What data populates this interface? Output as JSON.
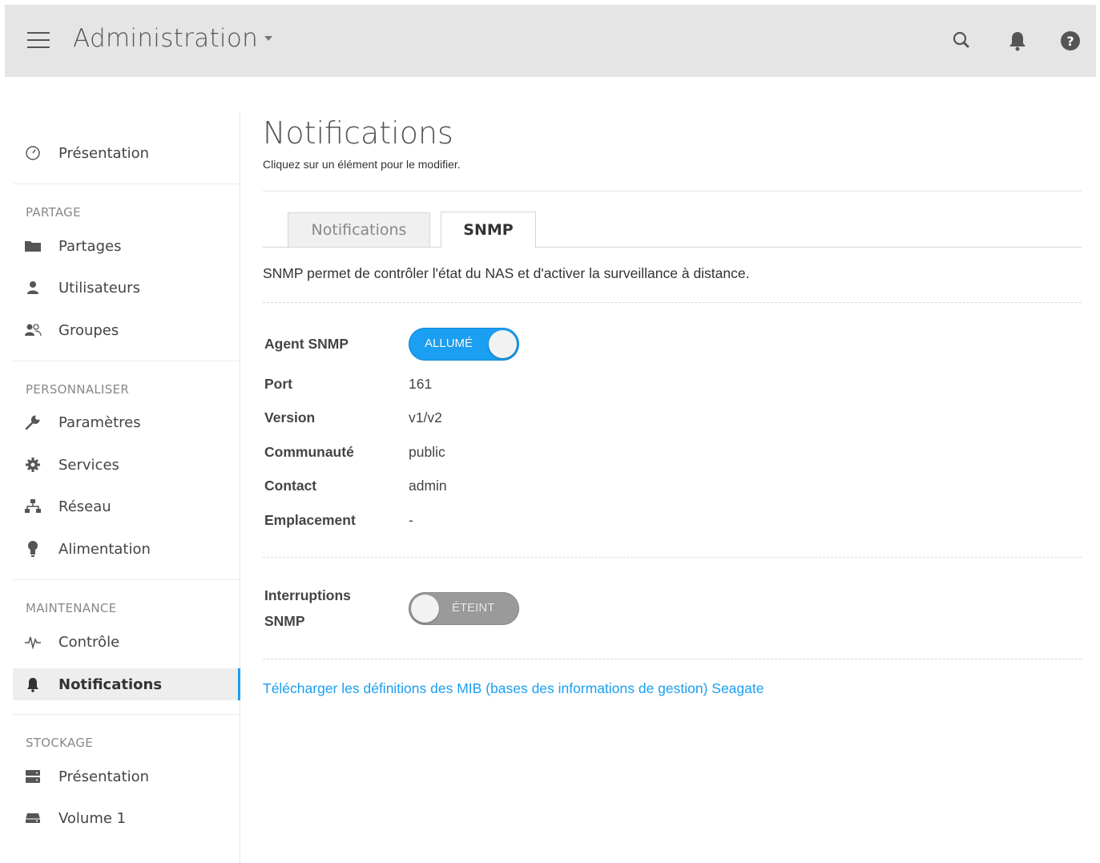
{
  "header": {
    "title": "Administration",
    "icons": [
      "menu-icon",
      "search-icon",
      "bell-icon",
      "help-icon"
    ]
  },
  "sidebar": {
    "top_item": {
      "label": "Présentation",
      "icon": "dashboard-icon"
    },
    "sections": [
      {
        "title": "PARTAGE",
        "items": [
          {
            "label": "Partages",
            "icon": "folder-icon"
          },
          {
            "label": "Utilisateurs",
            "icon": "user-icon"
          },
          {
            "label": "Groupes",
            "icon": "group-icon"
          }
        ]
      },
      {
        "title": "PERSONNALISER",
        "items": [
          {
            "label": "Paramètres",
            "icon": "wrench-icon"
          },
          {
            "label": "Services",
            "icon": "gear-icon"
          },
          {
            "label": "Réseau",
            "icon": "network-icon"
          },
          {
            "label": "Alimentation",
            "icon": "bulb-icon"
          }
        ]
      },
      {
        "title": "MAINTENANCE",
        "items": [
          {
            "label": "Contrôle",
            "icon": "pulse-icon"
          },
          {
            "label": "Notifications",
            "icon": "bell-icon",
            "active": true
          }
        ]
      },
      {
        "title": "STOCKAGE",
        "items": [
          {
            "label": "Présentation",
            "icon": "server-icon"
          },
          {
            "label": "Volume 1",
            "icon": "drive-icon"
          }
        ]
      }
    ]
  },
  "main": {
    "title": "Notifications",
    "subtitle": "Cliquez sur un élément pour le modifier.",
    "tabs": [
      {
        "label": "Notifications",
        "active": false
      },
      {
        "label": "SNMP",
        "active": true
      }
    ],
    "description": "SNMP permet de contrôler l'état du NAS et d'activer la surveillance à distance.",
    "agent": {
      "label": "Agent SNMP",
      "toggle": "ALLUMÉ",
      "state": "on"
    },
    "fields": [
      {
        "label": "Port",
        "value": "161"
      },
      {
        "label": "Version",
        "value": "v1/v2"
      },
      {
        "label": "Communauté",
        "value": "public"
      },
      {
        "label": "Contact",
        "value": "admin"
      },
      {
        "label": "Emplacement",
        "value": "-"
      }
    ],
    "interrupts": {
      "label_line1": "Interruptions",
      "label_line2": "SNMP",
      "toggle": "ÉTEINT",
      "state": "off"
    },
    "mib_link": "Télécharger les définitions des MIB (bases des informations de gestion) Seagate"
  },
  "colors": {
    "accent": "#1a9ff2",
    "header_bg": "#e5e5e5",
    "toggle_off": "#9a9a9a"
  }
}
